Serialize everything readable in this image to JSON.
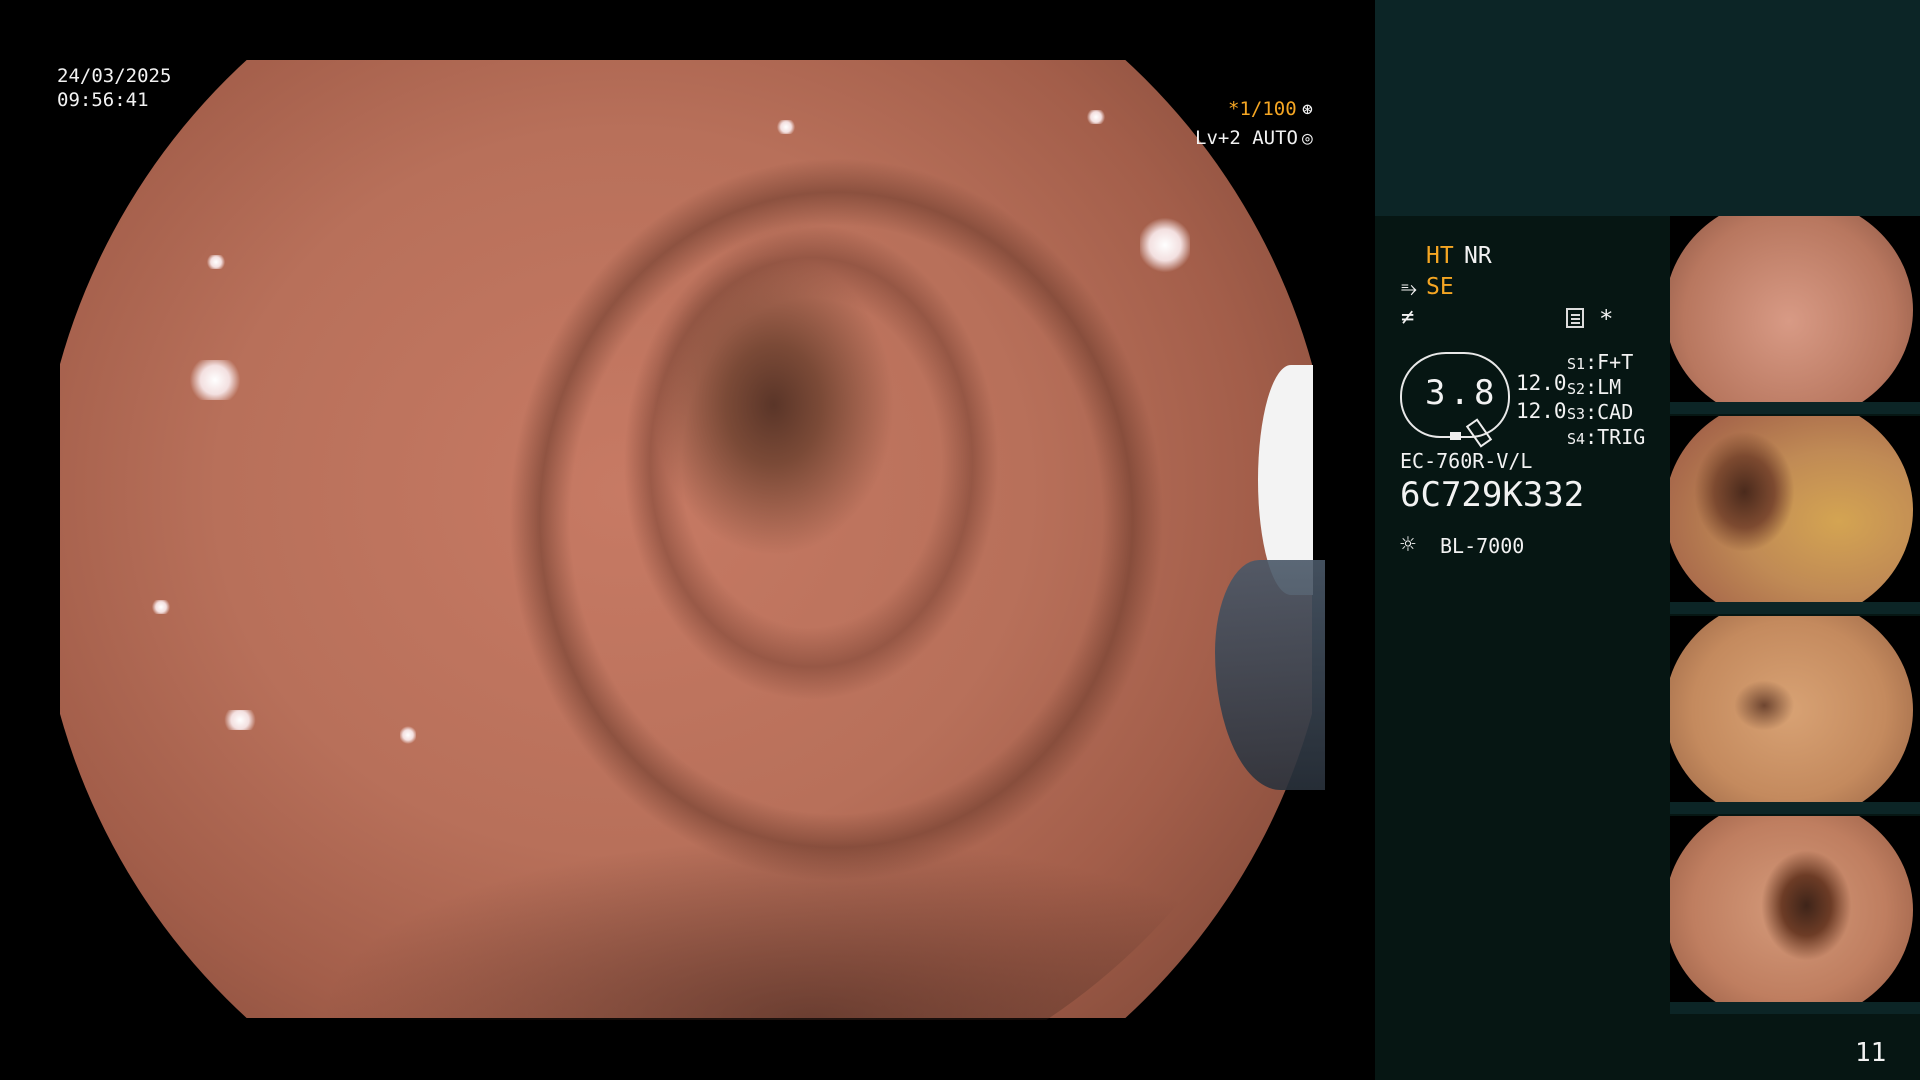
{
  "overlay": {
    "date": "24/03/2025",
    "time": "09:56:41",
    "shutter": "*1/100",
    "shutter_icon": "⊛",
    "level": "Lv+2 AUTO",
    "level_icon": "◎"
  },
  "panel": {
    "mode_ht": "HT",
    "mode_nr": "NR",
    "se_icon": "⥱",
    "mode_se": "SE",
    "neq_icon": "≠",
    "star": "*",
    "gauge_value": "3.8",
    "value_a": "12.0",
    "value_b": "12.0",
    "settings": [
      {
        "key": "S1",
        "value": "F+T"
      },
      {
        "key": "S2",
        "value": "LM"
      },
      {
        "key": "S3",
        "value": "CAD"
      },
      {
        "key": "S4",
        "value": "TRIG"
      }
    ],
    "scope_model": "EC-760R-V/L",
    "scope_serial": "6C729K332",
    "light_icon": "☼",
    "light_source": "BL-7000",
    "page_number": "11"
  },
  "colors": {
    "accent": "#f5a623",
    "panel_top": "#0c2526",
    "panel": "#061613"
  },
  "icons": [
    "shutter-icon",
    "auto-level-icon",
    "scope-se-icon",
    "not-equal-icon",
    "document-icon",
    "light-source-icon"
  ]
}
